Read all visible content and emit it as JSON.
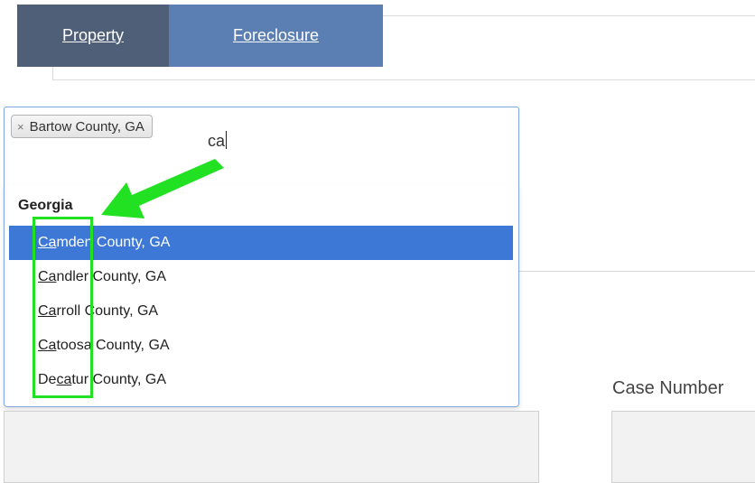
{
  "tabs": [
    {
      "label": "Property"
    },
    {
      "label": "Foreclosure"
    }
  ],
  "search": {
    "selected_tag": "Bartow County, GA",
    "remove_glyph": "×",
    "query": "ca"
  },
  "dropdown": {
    "group_label": "Georgia",
    "options": [
      {
        "match": "Ca",
        "rest": "mden County, GA",
        "highlighted": true
      },
      {
        "match": "Ca",
        "rest": "ndler County, GA",
        "highlighted": false
      },
      {
        "match": "Ca",
        "rest": "rroll County, GA",
        "highlighted": false
      },
      {
        "match": "Ca",
        "rest": "toosa County, GA",
        "highlighted": false
      },
      {
        "prefix": "De",
        "match": "ca",
        "rest": "tur County, GA",
        "highlighted": false
      }
    ]
  },
  "form": {
    "case_number_label": "Case Number"
  },
  "colors": {
    "tab_property": "#4f5f78",
    "tab_foreclosure": "#5b7fb2",
    "highlight": "#3d78d6",
    "annotation": "#22e022"
  }
}
